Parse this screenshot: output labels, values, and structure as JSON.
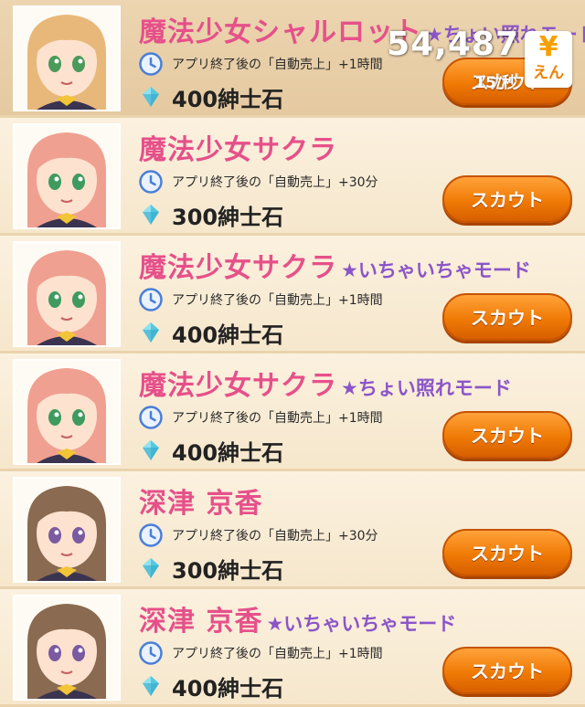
{
  "header": {
    "amount": "54,487",
    "rate": "15/秒",
    "currency_symbol": "¥",
    "currency_label": "えん"
  },
  "items": [
    {
      "name": "魔法少女シャルロット",
      "mode": "★ちょい照れモード",
      "detail": "アプリ終了後の「自動売上」+1時間",
      "price": "400紳士石",
      "button": "スカウト",
      "hair": "#e8b87a",
      "eyes": "#4a9a5a",
      "dim": true
    },
    {
      "name": "魔法少女サクラ",
      "mode": "",
      "detail": "アプリ終了後の「自動売上」+30分",
      "price": "300紳士石",
      "button": "スカウト",
      "hair": "#f0a090",
      "eyes": "#3f9a60",
      "dim": false
    },
    {
      "name": "魔法少女サクラ",
      "mode": "★いちゃいちゃモード",
      "detail": "アプリ終了後の「自動売上」+1時間",
      "price": "400紳士石",
      "button": "スカウト",
      "hair": "#f0a090",
      "eyes": "#3f9a60",
      "dim": false
    },
    {
      "name": "魔法少女サクラ",
      "mode": "★ちょい照れモード",
      "detail": "アプリ終了後の「自動売上」+1時間",
      "price": "400紳士石",
      "button": "スカウト",
      "hair": "#f0a090",
      "eyes": "#3f9a60",
      "dim": false
    },
    {
      "name": "深津 京香",
      "mode": "",
      "detail": "アプリ終了後の「自動売上」+30分",
      "price": "300紳士石",
      "button": "スカウト",
      "hair": "#8a6a50",
      "eyes": "#7a5aa0",
      "dim": false
    },
    {
      "name": "深津 京香",
      "mode": "★いちゃいちゃモード",
      "detail": "アプリ終了後の「自動売上」+1時間",
      "price": "400紳士石",
      "button": "スカウト",
      "hair": "#8a6a50",
      "eyes": "#7a5aa0",
      "dim": false
    }
  ]
}
